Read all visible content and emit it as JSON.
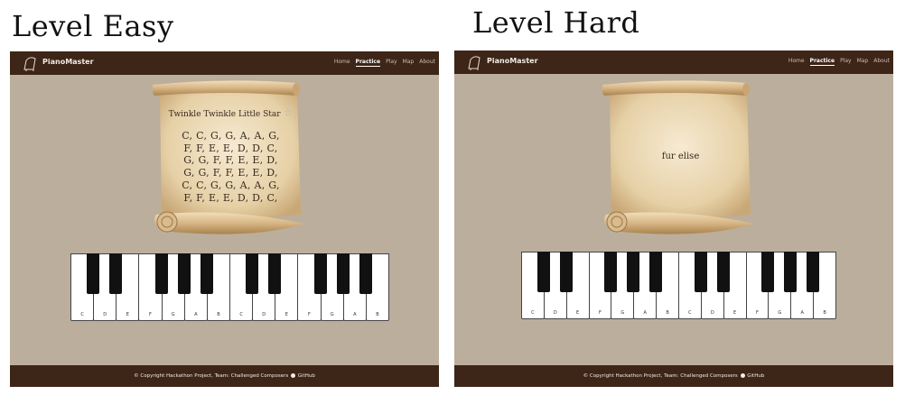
{
  "labels": {
    "easy": "Level Easy",
    "hard": "Level Hard"
  },
  "app": {
    "brand": "PianoMaster",
    "nav": [
      {
        "label": "Home"
      },
      {
        "label": "Practice",
        "active": true
      },
      {
        "label": "Play"
      },
      {
        "label": "Map"
      },
      {
        "label": "About"
      }
    ],
    "footer": {
      "copyright": "© Copyright Hackathon Project, Team: Challenged Composers",
      "github": "GitHub"
    }
  },
  "easy": {
    "song_title": "Twinkle Twinkle Little Star",
    "star_icon": "star-icon",
    "notes": [
      "C, C, G, G, A, A, G,",
      "F, F, E, E, D, D, C,",
      "G, G, F, F, E, E, D,",
      "G, G, F, F, E, E, D,",
      "C, C, G, G, A, A, G,",
      "F, F, E, E, D, D, C,"
    ]
  },
  "hard": {
    "song_title": "fur elise"
  },
  "piano": {
    "white_keys": [
      "C",
      "D",
      "E",
      "F",
      "G",
      "A",
      "B",
      "C",
      "D",
      "E",
      "F",
      "G",
      "A",
      "B"
    ]
  },
  "colors": {
    "navbar": "#3d2517",
    "background": "#bbae9c",
    "scroll": "#e9d6b0"
  }
}
